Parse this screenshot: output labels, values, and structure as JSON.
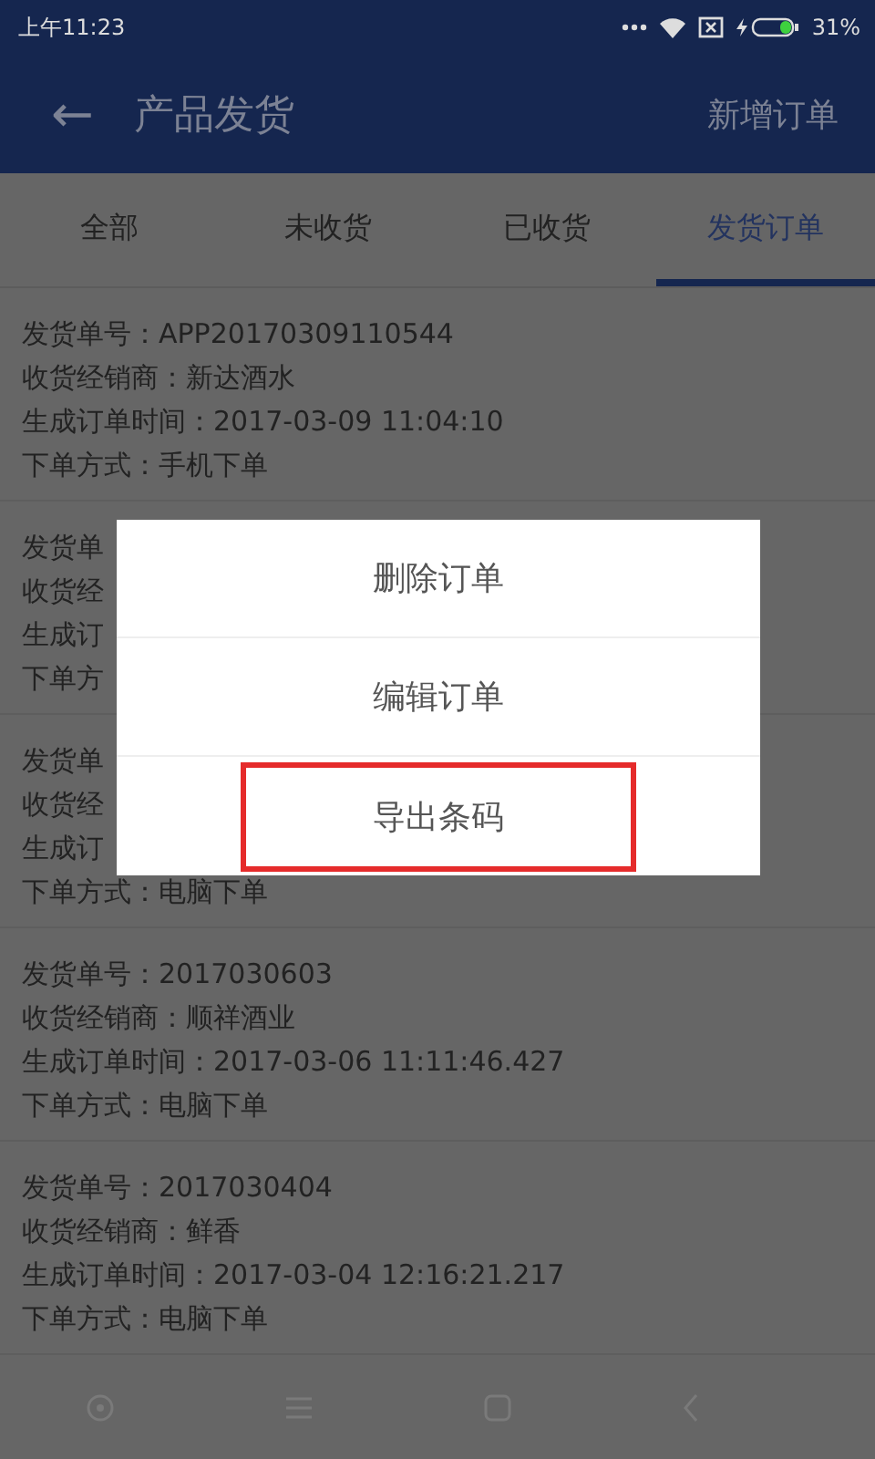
{
  "status_bar": {
    "time": "上午11:23",
    "battery": "31%"
  },
  "header": {
    "back": "←",
    "title": "产品发货",
    "action": "新增订单"
  },
  "tabs": [
    {
      "label": "全部",
      "selected": false
    },
    {
      "label": "未收货",
      "selected": false
    },
    {
      "label": "已收货",
      "selected": false
    },
    {
      "label": "发货订单",
      "selected": true
    }
  ],
  "orders": [
    {
      "lines": [
        "发货单号：APP20170309110544",
        "收货经销商：新达酒水",
        "生成订单时间：2017-03-09 11:04:10",
        "下单方式：手机下单"
      ]
    },
    {
      "lines": [
        "发货单",
        "收货经",
        "生成订",
        "下单方"
      ]
    },
    {
      "lines": [
        "发货单",
        "收货经",
        "生成订",
        "下单方式：电脑下单"
      ]
    },
    {
      "lines": [
        "发货单号：2017030603",
        "收货经销商：顺祥酒业",
        "生成订单时间：2017-03-06 11:11:46.427",
        "下单方式：电脑下单"
      ]
    },
    {
      "lines": [
        "发货单号：2017030404",
        "收货经销商：鲜香",
        "生成订单时间：2017-03-04 12:16:21.217",
        "下单方式：电脑下单"
      ]
    }
  ],
  "menu": {
    "items": [
      {
        "label": "删除订单",
        "highlighted": false
      },
      {
        "label": "编辑订单",
        "highlighted": false
      },
      {
        "label": "导出条码",
        "highlighted": true
      }
    ]
  }
}
